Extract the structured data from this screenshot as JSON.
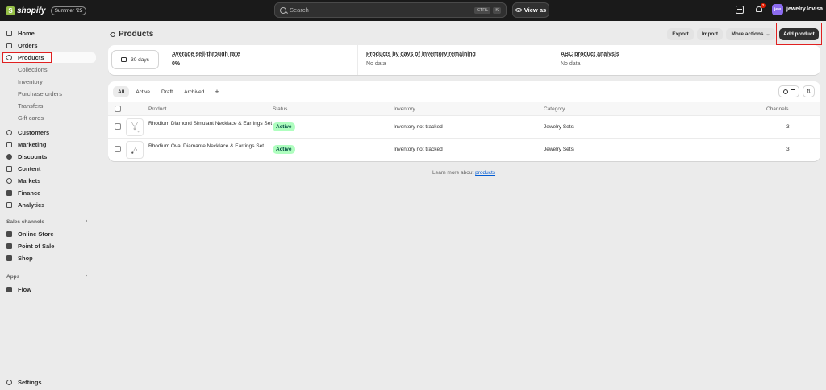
{
  "topbar": {
    "brand": "shopify",
    "edition": "Summer '25",
    "search_placeholder": "Search",
    "kbd_ctrl": "CTRL",
    "kbd_key": "K",
    "view_as": "View as",
    "notification_count": "2",
    "avatar_initials": "jew",
    "store_name": "jewelry.lovisa"
  },
  "sidebar": {
    "main": [
      "Home",
      "Orders",
      "Products"
    ],
    "products_sub": [
      "Collections",
      "Inventory",
      "Purchase orders",
      "Transfers",
      "Gift cards"
    ],
    "more": [
      "Customers",
      "Marketing",
      "Discounts",
      "Content",
      "Markets",
      "Finance",
      "Analytics"
    ],
    "sales_channels_label": "Sales channels",
    "sales_channels": [
      "Online Store",
      "Point of Sale",
      "Shop"
    ],
    "apps_label": "Apps",
    "apps": [
      "Flow"
    ],
    "settings": "Settings"
  },
  "page": {
    "title": "Products",
    "export": "Export",
    "import": "Import",
    "more_actions": "More actions",
    "add_product": "Add product"
  },
  "analytics": {
    "period": "30 days",
    "sell_through_title": "Average sell-through rate",
    "sell_through_value": "0%",
    "sell_through_dash": "—",
    "days_inventory_title": "Products by days of inventory remaining",
    "days_inventory_value": "No data",
    "abc_title": "ABC product analysis",
    "abc_value": "No data"
  },
  "tabs": [
    "All",
    "Active",
    "Draft",
    "Archived"
  ],
  "tab_add": "+",
  "table": {
    "headers": {
      "product": "Product",
      "status": "Status",
      "inventory": "Inventory",
      "category": "Category",
      "channels": "Channels"
    },
    "rows": [
      {
        "name": "Rhodium Diamond Simulant Necklace & Earrings Set",
        "status": "Active",
        "inventory": "Inventory not tracked",
        "category": "Jewelry Sets",
        "channels": "3"
      },
      {
        "name": "Rhodium Oval Diamante Necklace & Earrings Set",
        "status": "Active",
        "inventory": "Inventory not tracked",
        "category": "Jewelry Sets",
        "channels": "3"
      }
    ]
  },
  "footer": {
    "learn_more_prefix": "Learn more about ",
    "learn_more_link": "products"
  },
  "colors": {
    "topbar_bg": "#1a1a1a",
    "brand_green": "#95bf47",
    "active_badge_bg": "#affebf",
    "primary_button": "#303030",
    "highlight": "#e02020",
    "link": "#005bd3"
  }
}
